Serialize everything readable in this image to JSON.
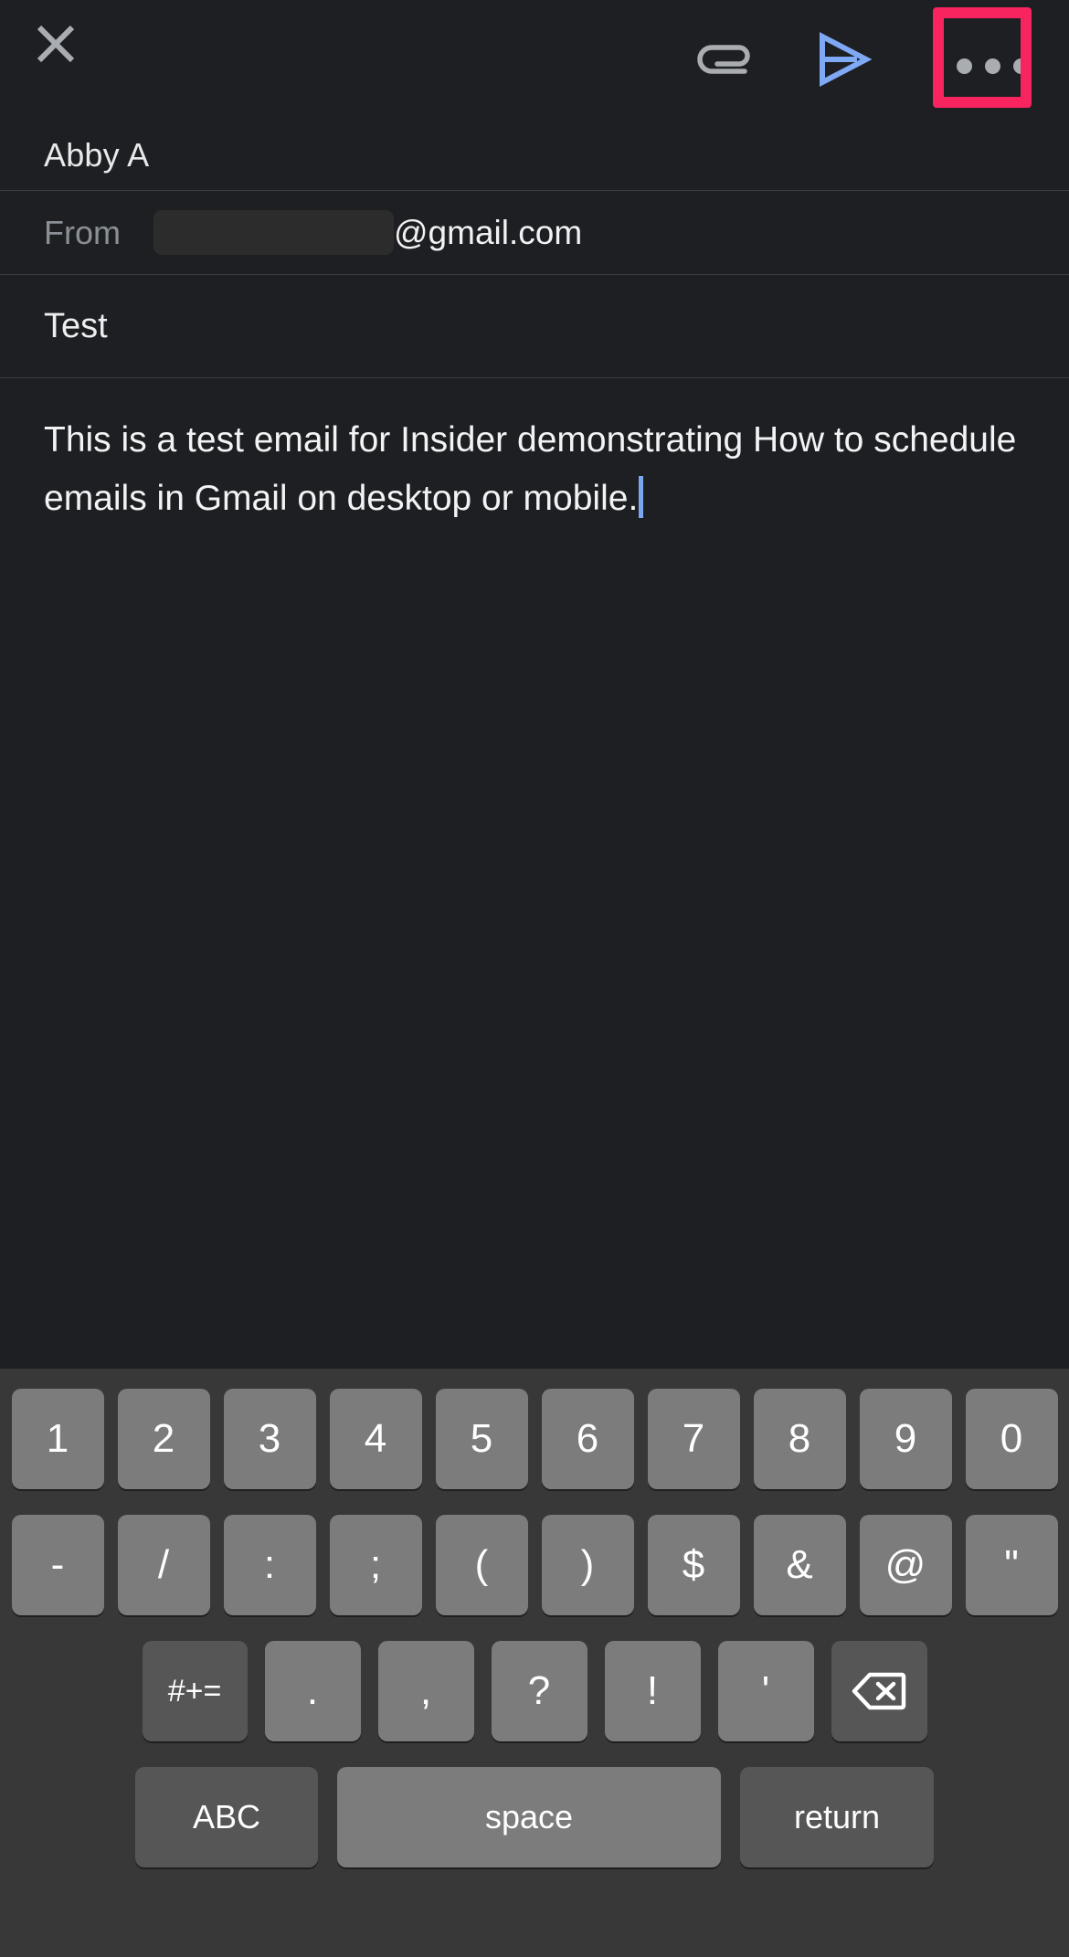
{
  "toolbar": {
    "close_label": "close-icon",
    "attach_label": "attachment-icon",
    "send_label": "send-icon",
    "more_label": "more-options-icon",
    "highlight_color": "#f8245f",
    "send_color": "#7fa8f5"
  },
  "compose": {
    "to": "Abby A",
    "from_label": "From",
    "from_redacted": "",
    "from_domain": "@gmail.com",
    "subject": "Test",
    "body": "This is a test email for Insider demonstrating How to schedule emails in Gmail on desktop or mobile."
  },
  "keyboard": {
    "row1": [
      "1",
      "2",
      "3",
      "4",
      "5",
      "6",
      "7",
      "8",
      "9",
      "0"
    ],
    "row2": [
      "-",
      "/",
      ":",
      ";",
      "(",
      ")",
      "$",
      "&",
      "@",
      "\""
    ],
    "row3_shift": "#+=",
    "row3": [
      ".",
      ",",
      "?",
      "!",
      "'"
    ],
    "row3_delete": "delete-icon",
    "row4": {
      "abc": "ABC",
      "space": "space",
      "return": "return"
    }
  }
}
